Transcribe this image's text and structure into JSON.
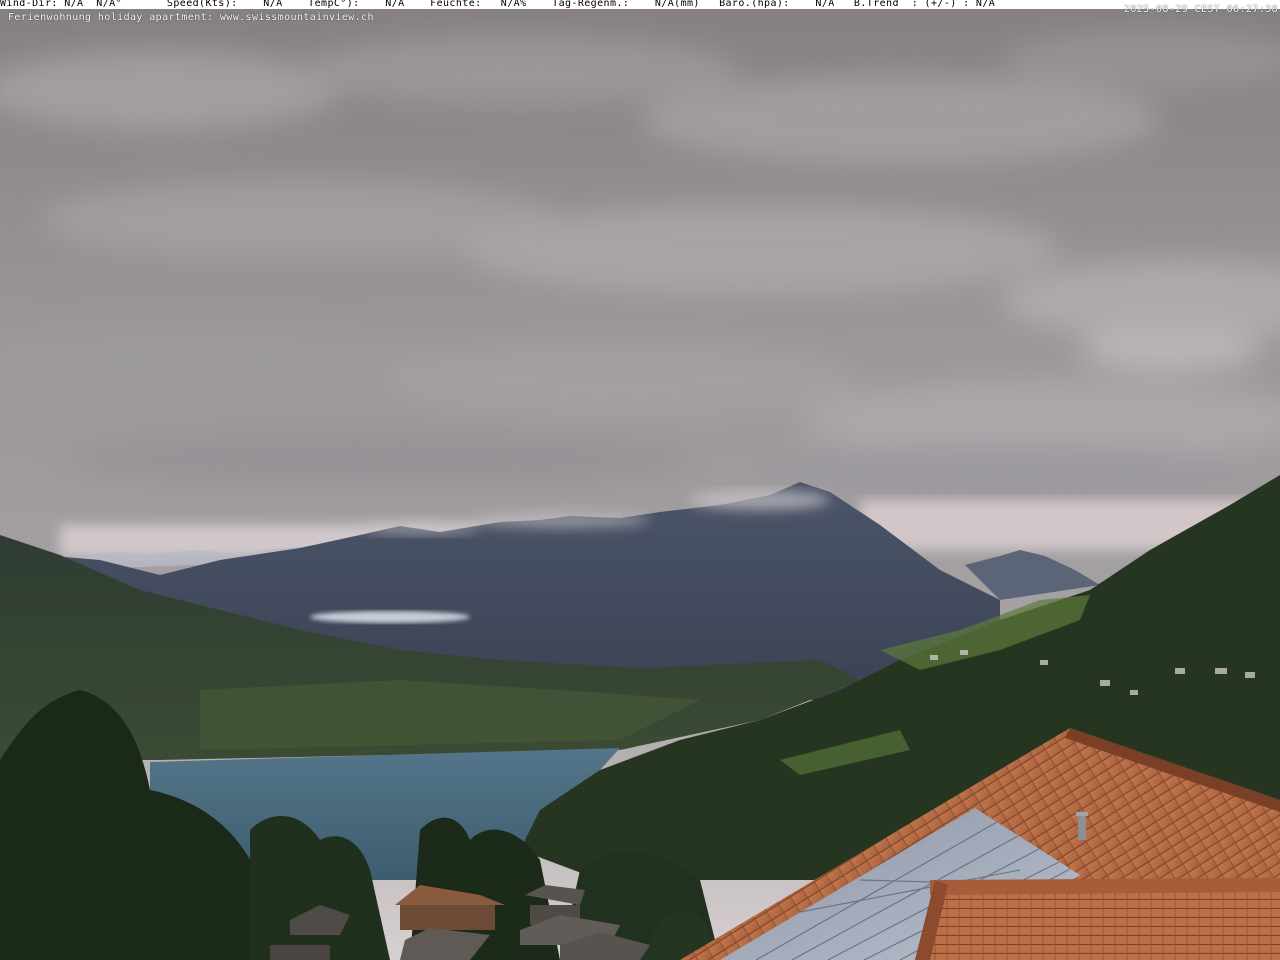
{
  "overlay": {
    "weather_line": "Wind-Dir: N/A  N/A°       Speed(Kts):    N/A    TempC°):    N/A    Feuchte:   N/A%    Tag-Regenm.:    N/A(mm)   Baro.(hpa):    N/A   B.Trend  : (+/-) : N/A",
    "caption": "Ferienwohnung holiday apartment: www.swissmountainview.ch",
    "timestamp": "2025-08-29 CEST 06:27:38"
  },
  "colors": {
    "sky_top": "#8a8688",
    "sky_mid": "#a3a0a2",
    "sky_horizon": "#c9c4c8",
    "mountain": "#3a4457",
    "lake": "#4a6a80",
    "forest": "#233322",
    "roof": "#b56a44",
    "solar_panel": "#9aa2b4"
  }
}
